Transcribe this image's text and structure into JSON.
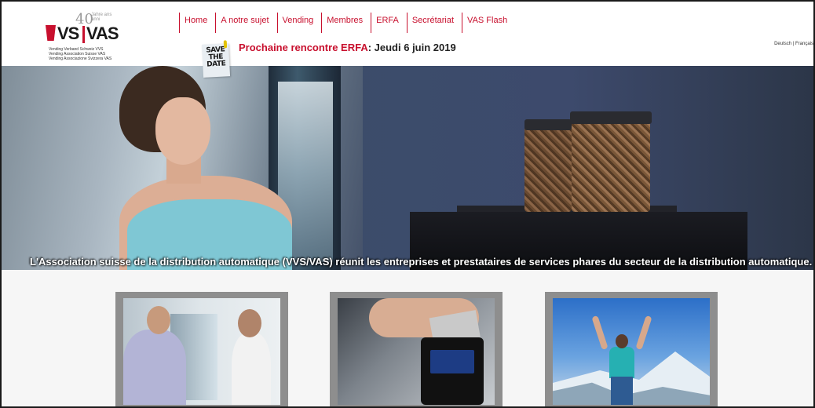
{
  "header": {
    "logo": {
      "brand_left": "VS",
      "brand_right": "VAS",
      "anniversary": "40",
      "anniversary_sub": "Jahre ans anni",
      "tagline": [
        "Vending Verband Schweiz VVS",
        "Vending Association Suisse VAS",
        "Vending Associazione Svizzera VAS"
      ]
    },
    "nav": [
      "Home",
      "A notre sujet",
      "Vending",
      "Membres",
      "ERFA",
      "Secrétariat",
      "VAS Flash"
    ],
    "save_the_date": [
      "SAVE",
      "THE",
      "DATE"
    ],
    "meeting": {
      "label": "Prochaine rencontre ERFA",
      "date": ": Jeudi 6 juin 2019"
    },
    "languages": {
      "de": "Deutsch",
      "sep": " | ",
      "fr": "Français"
    }
  },
  "hero": {
    "caption": "L'Association suisse de la distribution automatique (VVS/VAS) réunit les entreprises et prestataires de services phares du secteur de la distribution automatique."
  },
  "colors": {
    "accent": "#c8102e",
    "card_frame": "#8e8e8e"
  }
}
